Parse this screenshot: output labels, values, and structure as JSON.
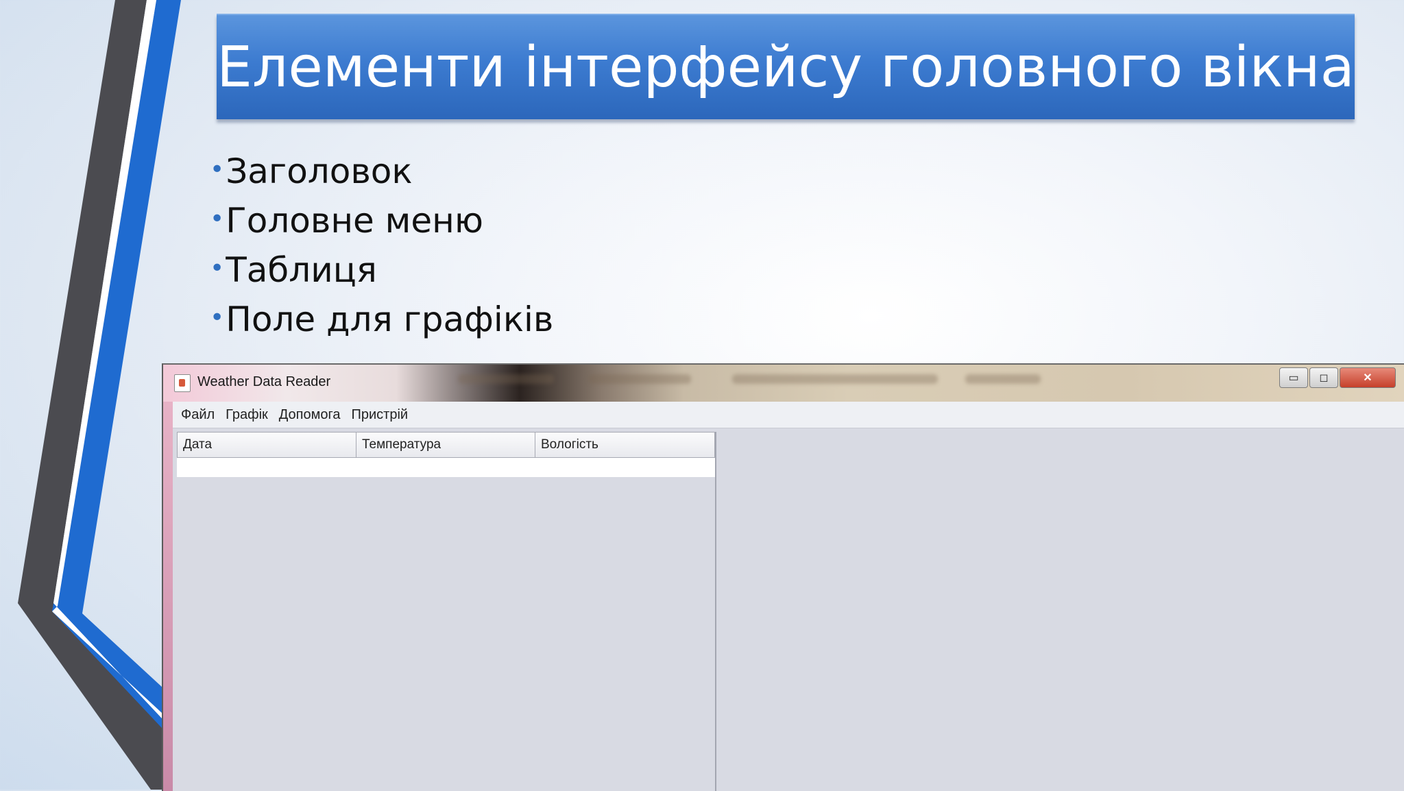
{
  "slide": {
    "title": "Елементи інтерфейсу головного вікна",
    "bullets": [
      "Заголовок",
      "Головне меню",
      "Таблиця",
      "Поле для графіків"
    ],
    "bullet_glyph": "•",
    "colors": {
      "title_bar": "#3c7bd0",
      "accent_blue": "#1f6bd0",
      "accent_dark": "#4a4a4e"
    }
  },
  "window": {
    "title": "Weather Data Reader",
    "icon": "java-app-icon",
    "controls": {
      "minimize": "▭",
      "maximize": "◻",
      "close": "✕"
    },
    "menu": [
      "Файл",
      "Графік",
      "Допомога",
      "Пристрій"
    ],
    "table": {
      "columns": [
        "Дата",
        "Температура",
        "Вологість"
      ],
      "rows": []
    }
  }
}
